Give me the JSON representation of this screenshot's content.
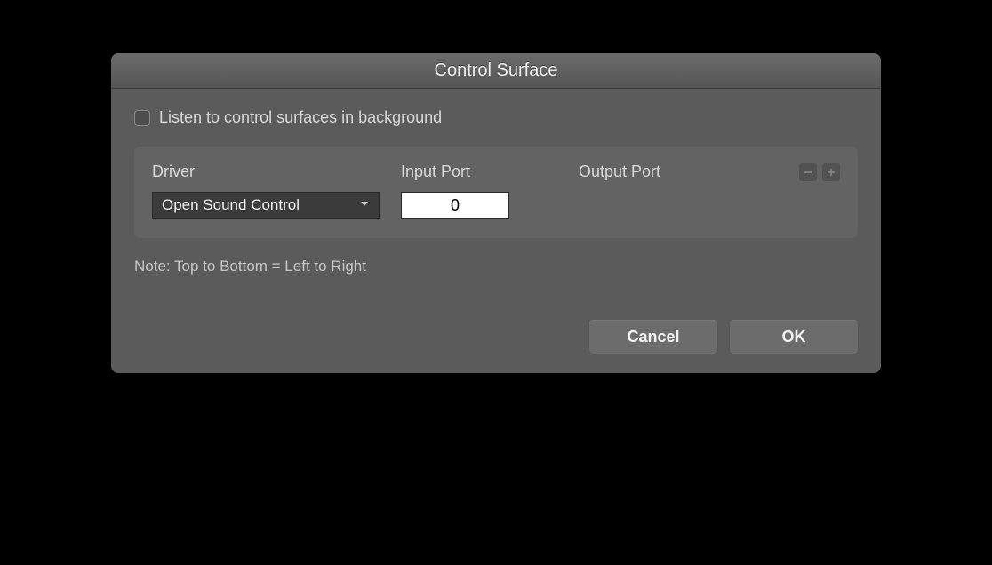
{
  "dialog": {
    "title": "Control Surface",
    "checkbox": {
      "label": "Listen to control surfaces in background",
      "checked": false
    },
    "panel": {
      "columns": {
        "driver": "Driver",
        "input_port": "Input Port",
        "output_port": "Output Port"
      },
      "row": {
        "driver_value": "Open Sound Control",
        "input_port_value": "0",
        "output_port_value": ""
      }
    },
    "note": "Note: Top to Bottom = Left to Right",
    "buttons": {
      "cancel": "Cancel",
      "ok": "OK"
    }
  }
}
